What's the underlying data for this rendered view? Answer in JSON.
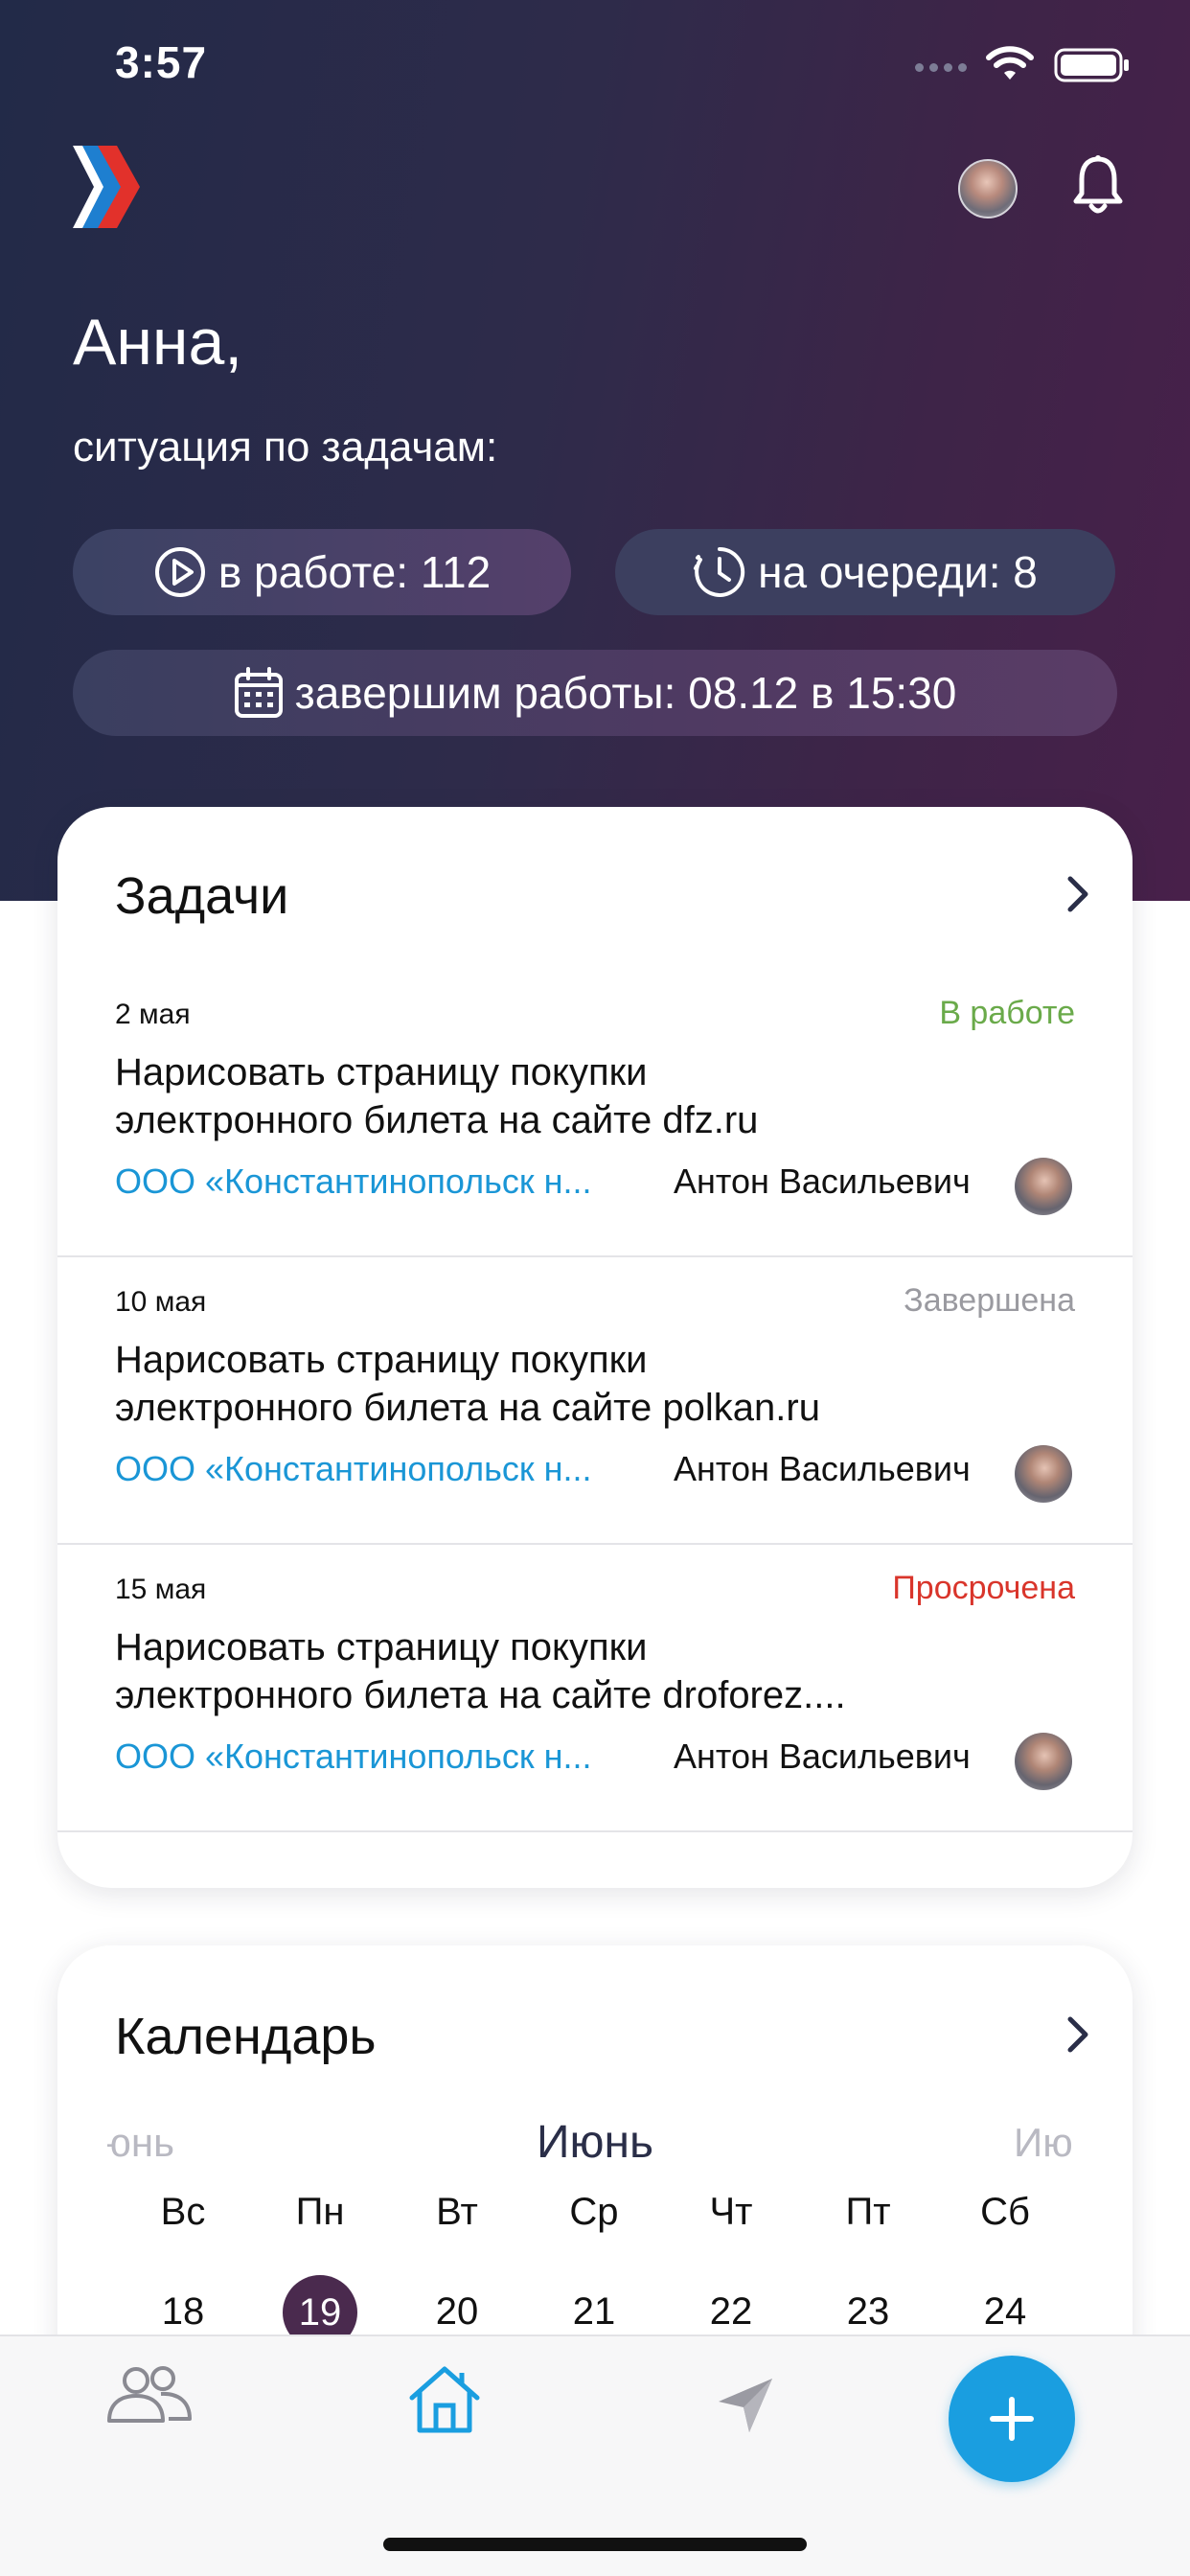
{
  "status_bar": {
    "time": "3:57"
  },
  "header": {
    "greeting": "Анна,",
    "subtitle": "ситуация по задачам:",
    "pills": {
      "in_work": "в работе: 112",
      "queued": "на очереди: 8",
      "finish": "завершим работы: 08.12 в 15:30"
    }
  },
  "tasks": {
    "title": "Задачи",
    "items": [
      {
        "date": "2 мая",
        "status": "В работе",
        "title_line1": "Нарисовать страницу покупки",
        "title_line2": "электронного билета на сайте dfz.ru",
        "org": "ООО «Константинопольск н...",
        "person": "Антон Васильевич"
      },
      {
        "date": "10 мая",
        "status": "Завершена",
        "title_line1": "Нарисовать страницу покупки",
        "title_line2": "электронного билета на сайте polkan.ru",
        "org": "ООО «Константинопольск н...",
        "person": "Антон Васильевич"
      },
      {
        "date": "15 мая",
        "status": "Просрочена",
        "title_line1": "Нарисовать страницу покупки",
        "title_line2": "электронного билета на сайте droforez....",
        "org": "ООО «Константинопольск н...",
        "person": "Антон Васильевич"
      }
    ]
  },
  "calendar": {
    "title": "Календарь",
    "month_prev": "юнь",
    "month_current": "Июнь",
    "month_next": "Ию",
    "weekdays": [
      "Вс",
      "Пн",
      "Вт",
      "Ср",
      "Чт",
      "Пт",
      "Сб"
    ],
    "days": [
      "18",
      "19",
      "20",
      "21",
      "22",
      "23",
      "24"
    ],
    "selected_day": "19"
  },
  "colors": {
    "accent": "#1a9ee0",
    "status_in_work": "#6aaa4a",
    "status_done": "#9a9aa0",
    "status_overdue": "#d9352b",
    "org_link": "#1a96d6",
    "selected_day": "#4a2a4e"
  },
  "icons": {
    "logo": "chevron-logo",
    "bell": "bell-icon",
    "play": "play-circle-icon",
    "clock": "clock-icon",
    "calendar": "calendar-icon",
    "people": "people-icon",
    "home": "home-icon",
    "send": "send-icon",
    "plus": "plus-icon"
  }
}
